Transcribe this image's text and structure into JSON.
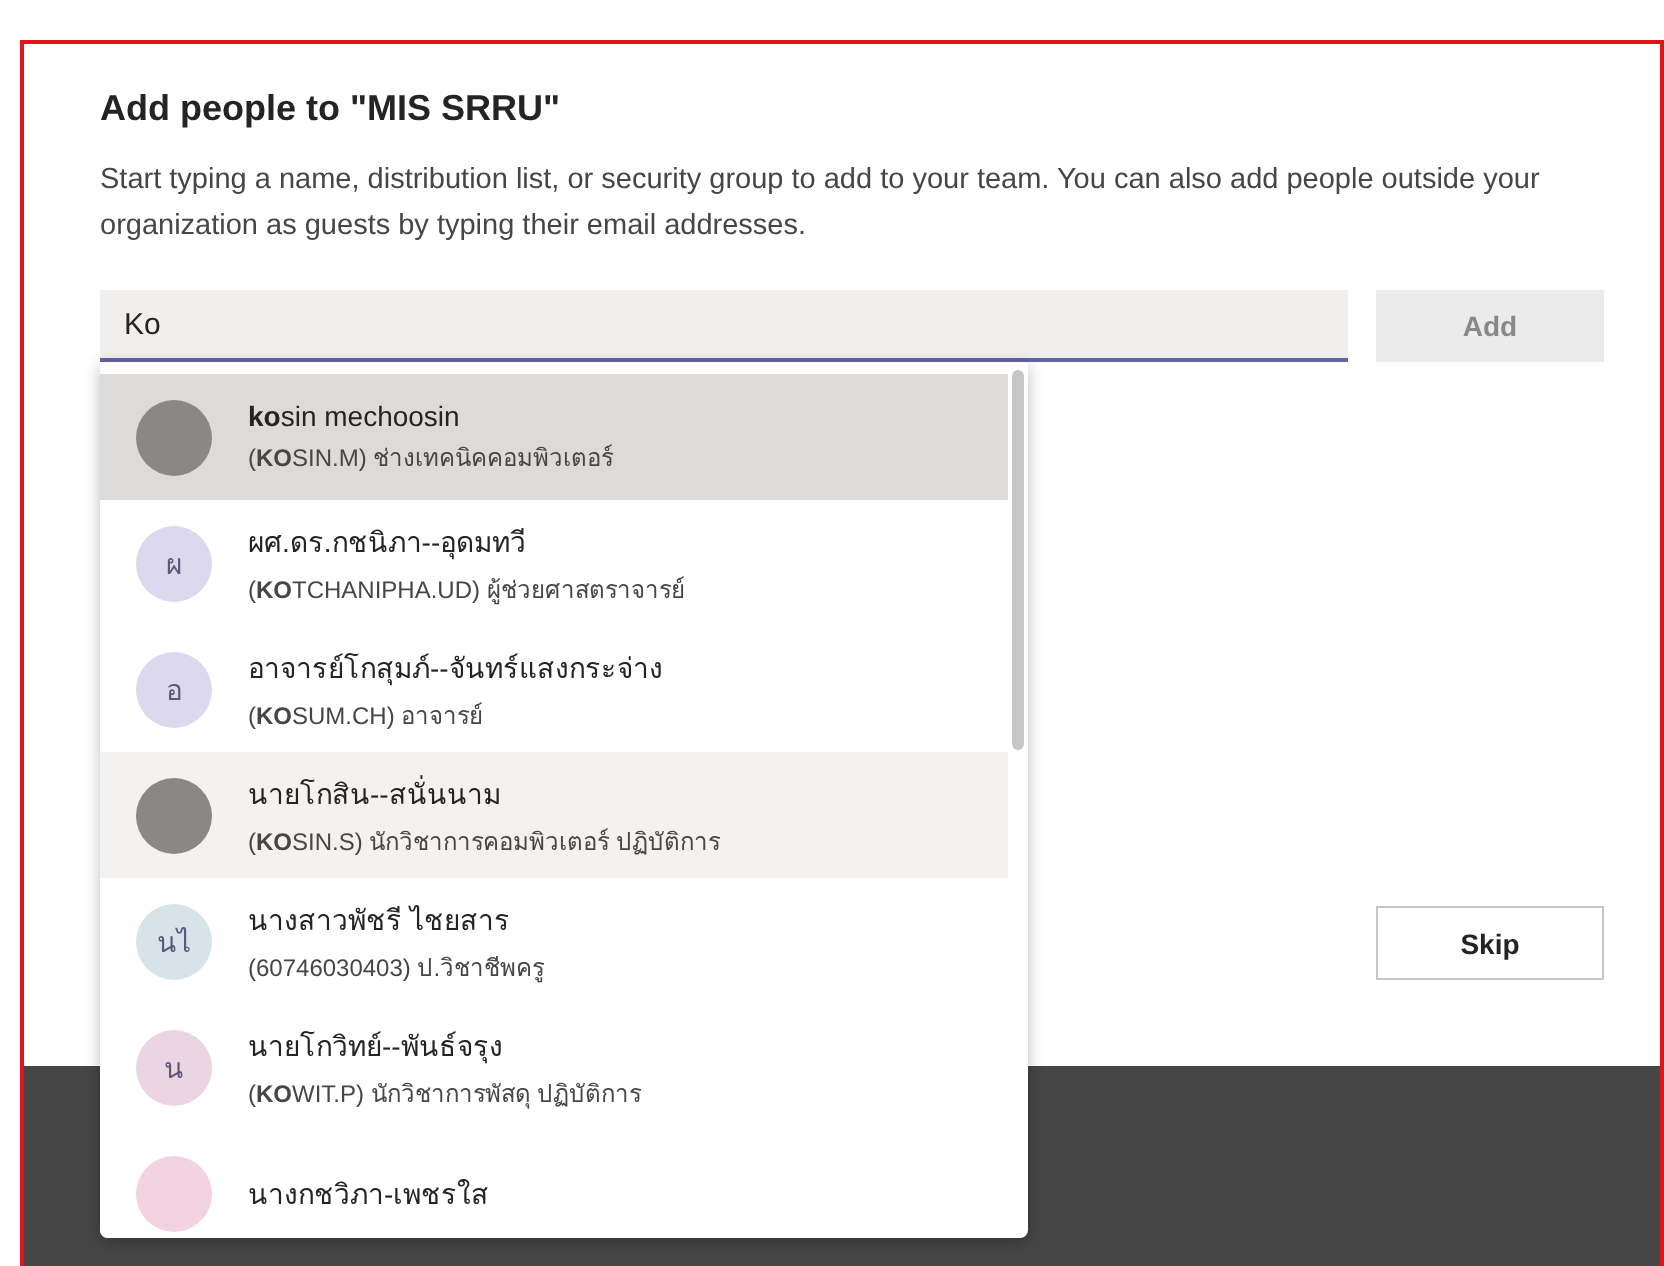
{
  "dialog": {
    "title": "Add people to \"MIS SRRU\"",
    "description": "Start typing a name, distribution list, or security group to add to your team. You can also add people outside your organization as guests by typing their email addresses.",
    "search": {
      "value": "Ko"
    },
    "add_button": {
      "label": "Add",
      "disabled": true
    },
    "skip_button": {
      "label": "Skip"
    },
    "suggestions": [
      {
        "kind": "photo",
        "name": "**ko**sin mechoosin",
        "detail": "(**KO**SIN.M) ช่างเทคนิคคอมพิวเตอร์",
        "selected": true,
        "hovered": false
      },
      {
        "kind": "initials",
        "initials": "ผ",
        "color": "#dcd9ee",
        "name": "ผศ.ดร.กชนิภา--อุดมทวี",
        "detail": "(**KO**TCHANIPHA.UD) ผู้ช่วยศาสตราจารย์",
        "selected": false,
        "hovered": false
      },
      {
        "kind": "initials",
        "initials": "อ",
        "color": "#dcd9ee",
        "name": "อาจารย์โกสุมภ์--จันทร์แสงกระจ่าง",
        "detail": "(**KO**SUM.CH) อาจารย์",
        "selected": false,
        "hovered": false
      },
      {
        "kind": "photo",
        "name": "นายโกสิน--สนั่นนาม",
        "detail": "(**KO**SIN.S) นักวิชาการคอมพิวเตอร์ ปฏิบัติการ",
        "selected": false,
        "hovered": true
      },
      {
        "kind": "initials",
        "initials": "นไ",
        "color": "#d6e4ea",
        "name": "นางสาวพัชรี ไชยสาร",
        "detail": "(60746030403) ป.วิชาชีพครู",
        "selected": false,
        "hovered": false
      },
      {
        "kind": "initials",
        "initials": "น",
        "color": "#ecd5e3",
        "name": "นายโกวิทย์--พันธ์จรุง",
        "detail": "(**KO**WIT.P) นักวิชาการพัสดุ ปฏิบัติการ",
        "selected": false,
        "hovered": false
      },
      {
        "kind": "initials",
        "color": "#f2d3df",
        "name": "นางกชวิภา-เพชรใส",
        "selected": false,
        "hovered": false
      }
    ]
  }
}
